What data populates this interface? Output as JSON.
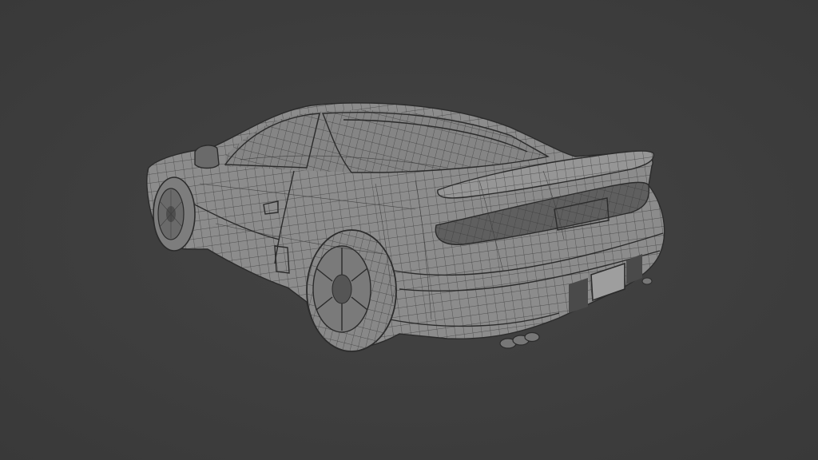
{
  "viewport": {
    "background_color": "#3d3d3d",
    "mesh_color": "#8c8c8c",
    "wire_color": "#3a3a3a"
  },
  "subject": {
    "icon": "wireframe-sports-car-model"
  }
}
